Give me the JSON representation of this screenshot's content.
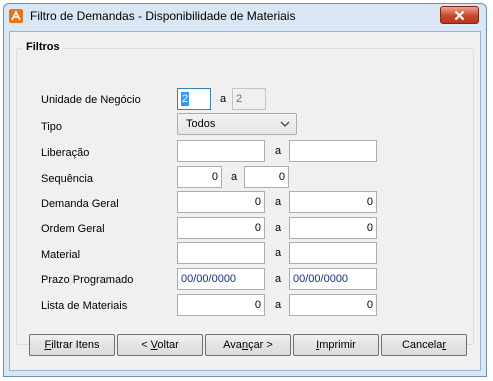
{
  "window": {
    "title": "Filtro de Demandas - Disponibilidade de Materiais",
    "close_glyph": "✕"
  },
  "filters": {
    "group_title": "Filtros",
    "separator": "a",
    "unidade": {
      "label": "Unidade de Negócio",
      "from": "2",
      "to": "2"
    },
    "tipo": {
      "label": "Tipo",
      "value": "Todos"
    },
    "liberacao": {
      "label": "Liberação",
      "from": "",
      "to": ""
    },
    "sequencia": {
      "label": "Sequência",
      "from": "0",
      "to": "0"
    },
    "demanda_geral": {
      "label": "Demanda Geral",
      "from": "0",
      "to": "0"
    },
    "ordem_geral": {
      "label": "Ordem Geral",
      "from": "0",
      "to": "0"
    },
    "material": {
      "label": "Material",
      "from": "",
      "to": ""
    },
    "prazo": {
      "label": "Prazo Programado",
      "from": "00/00/0000",
      "to": "00/00/0000"
    },
    "lista": {
      "label": "Lista de Materiais",
      "from": "0",
      "to": "0"
    }
  },
  "buttons": {
    "filtrar": {
      "mnemonic": "F",
      "rest": "iltrar Itens"
    },
    "voltar": {
      "pre": "< ",
      "mnemonic": "V",
      "rest": "oltar"
    },
    "avancar": {
      "pre": "Ava",
      "mnemonic": "n",
      "rest": "çar >"
    },
    "imprimir": {
      "mnemonic": "I",
      "rest": "mprimir"
    },
    "cancelar": {
      "pre": "Cancela",
      "mnemonic": "r",
      "rest": ""
    }
  },
  "colors": {
    "selection": "#3399ff",
    "date_text": "#1a2f7a",
    "close_button": "#c7472c"
  }
}
